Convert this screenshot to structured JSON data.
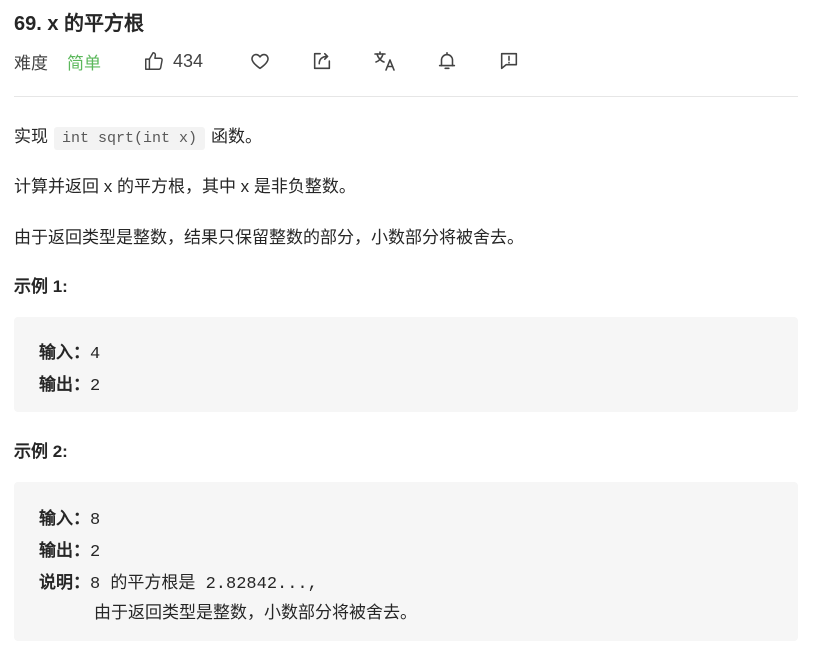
{
  "problem": {
    "title": "69. x 的平方根",
    "difficulty_label": "难度",
    "difficulty": "简单",
    "likes": "434",
    "icons": [
      "thumbs-up-icon",
      "heart-icon",
      "share-icon",
      "translate-icon",
      "bell-icon",
      "feedback-icon"
    ],
    "difficulty_color": "#5cb85c"
  },
  "description": {
    "p1_prefix": "实现",
    "p1_code": "int sqrt(int x)",
    "p1_suffix": "函数。",
    "p2": "计算并返回 x 的平方根，其中 x 是非负整数。",
    "p3": "由于返回类型是整数，结果只保留整数的部分，小数部分将被舍去。"
  },
  "examples": [
    {
      "title": "示例 1:",
      "input_label": "输入：",
      "input": "4",
      "output_label": "输出：",
      "output": "2"
    },
    {
      "title": "示例 2:",
      "input_label": "输入：",
      "input": "8",
      "output_label": "输出：",
      "output": "2",
      "explain_label": "说明：",
      "explain_value": "8",
      "explain_text": "的平方根是",
      "explain_result": "2.82842...,",
      "explain_cont": "由于返回类型是整数，小数部分将被舍去。"
    }
  ]
}
